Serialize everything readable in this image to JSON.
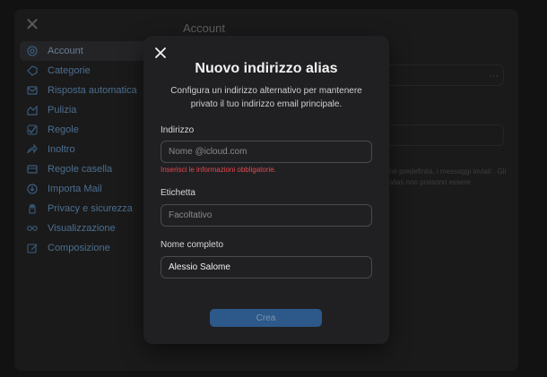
{
  "background": {
    "section_title": "Account",
    "sidebar": {
      "items": [
        {
          "label": "Account",
          "icon": "at-icon",
          "active": true
        },
        {
          "label": "Categorie",
          "icon": "tag-icon",
          "active": false
        },
        {
          "label": "Risposta automatica",
          "icon": "reply-icon",
          "active": false
        },
        {
          "label": "Pulizia",
          "icon": "broom-icon",
          "active": false
        },
        {
          "label": "Regole",
          "icon": "rules-icon",
          "active": false
        },
        {
          "label": "Inoltro",
          "icon": "forward-icon",
          "active": false
        },
        {
          "label": "Regole casella",
          "icon": "mailbox-icon",
          "active": false
        },
        {
          "label": "Importa Mail",
          "icon": "import-icon",
          "active": false
        },
        {
          "label": "Privacy e sicurezza",
          "icon": "hand-icon",
          "active": false
        },
        {
          "label": "Visualizzazione",
          "icon": "glasses-icon",
          "active": false
        },
        {
          "label": "Composizione",
          "icon": "compose-icon",
          "active": false
        }
      ]
    },
    "more_label": "···",
    "partial_text": "ne predefinita, i messaggi inviati . Gli alias non possono essere"
  },
  "modal": {
    "title": "Nuovo indirizzo alias",
    "description": "Configura un indirizzo alternativo per mantenere privato il tuo indirizzo email principale.",
    "fields": {
      "address": {
        "label": "Indirizzo",
        "placeholder": "Nome @icloud.com",
        "value": "",
        "error": "Inserisci le informazioni obbligatorie."
      },
      "label": {
        "label": "Etichetta",
        "placeholder": "Facoltativo",
        "value": ""
      },
      "full_name": {
        "label": "Nome completo",
        "placeholder": "",
        "value": "Alessio Salome"
      }
    },
    "create_label": "Crea"
  },
  "colors": {
    "accent": "#2c5989",
    "error": "#e5484d",
    "modal_bg": "#202023"
  }
}
